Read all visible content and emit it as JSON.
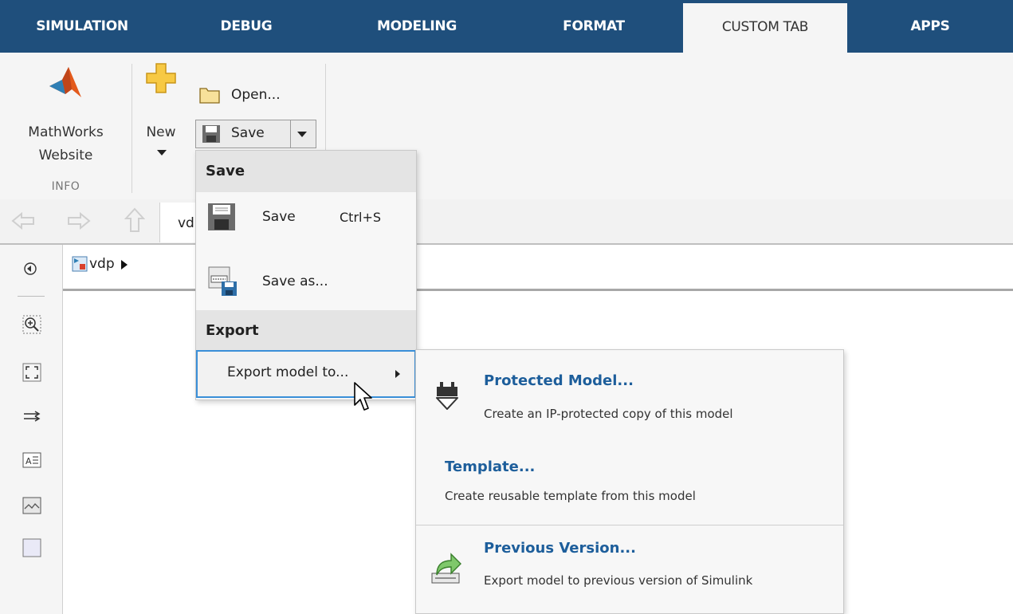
{
  "tabs": [
    {
      "label": "SIMULATION",
      "active": false
    },
    {
      "label": "DEBUG",
      "active": false
    },
    {
      "label": "MODELING",
      "active": false
    },
    {
      "label": "FORMAT",
      "active": false
    },
    {
      "label": "CUSTOM TAB",
      "active": true
    },
    {
      "label": "APPS",
      "active": false
    }
  ],
  "toolstrip": {
    "mathworks_line1": "MathWorks",
    "mathworks_line2": "Website",
    "info_section": "INFO",
    "new_label": "New",
    "open_label": "Open...",
    "save_label": "Save"
  },
  "address": {
    "model_tab": "vd"
  },
  "breadcrumb": {
    "model": "vdp"
  },
  "save_menu": {
    "save_header": "Save",
    "save_item": "Save",
    "save_shortcut": "Ctrl+S",
    "save_as_item": "Save as...",
    "export_header": "Export",
    "export_item": "Export model to..."
  },
  "export_submenu": {
    "items": [
      {
        "title": "Protected Model...",
        "description": "Create an IP-protected copy of this model",
        "icon": "protected-model-icon"
      },
      {
        "title": "Template...",
        "description": "Create reusable template from this model",
        "icon": ""
      },
      {
        "title": "Previous Version...",
        "description": "Export model to previous version of Simulink",
        "icon": "previous-version-icon"
      }
    ]
  },
  "colors": {
    "tabbar": "#1f4f7c",
    "link_blue": "#1d5e9b",
    "highlight_border": "#3a8fd8"
  }
}
